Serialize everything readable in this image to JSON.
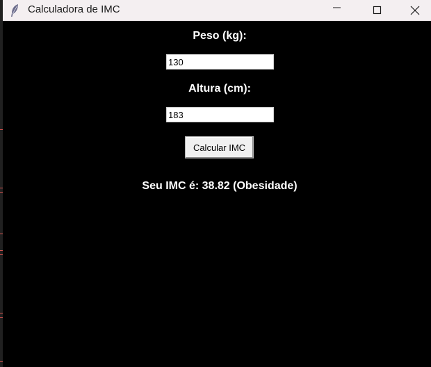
{
  "window": {
    "title": "Calculadora de IMC",
    "icon": "feather-icon"
  },
  "controls": {
    "minimize_icon": "minimize-icon",
    "maximize_icon": "maximize-icon",
    "close_icon": "close-icon"
  },
  "form": {
    "weight_label": "Peso (kg):",
    "weight_value": "130",
    "height_label": "Altura (cm):",
    "height_value": "183",
    "calculate_label": "Calcular IMC"
  },
  "result": {
    "text": "Seu IMC é: 38.82 (Obesidade)"
  },
  "colors": {
    "window_bg": "#000000",
    "text": "#ffffff",
    "titlebar_bg": "#f4eff1",
    "edge_accent": "#d9534f"
  }
}
